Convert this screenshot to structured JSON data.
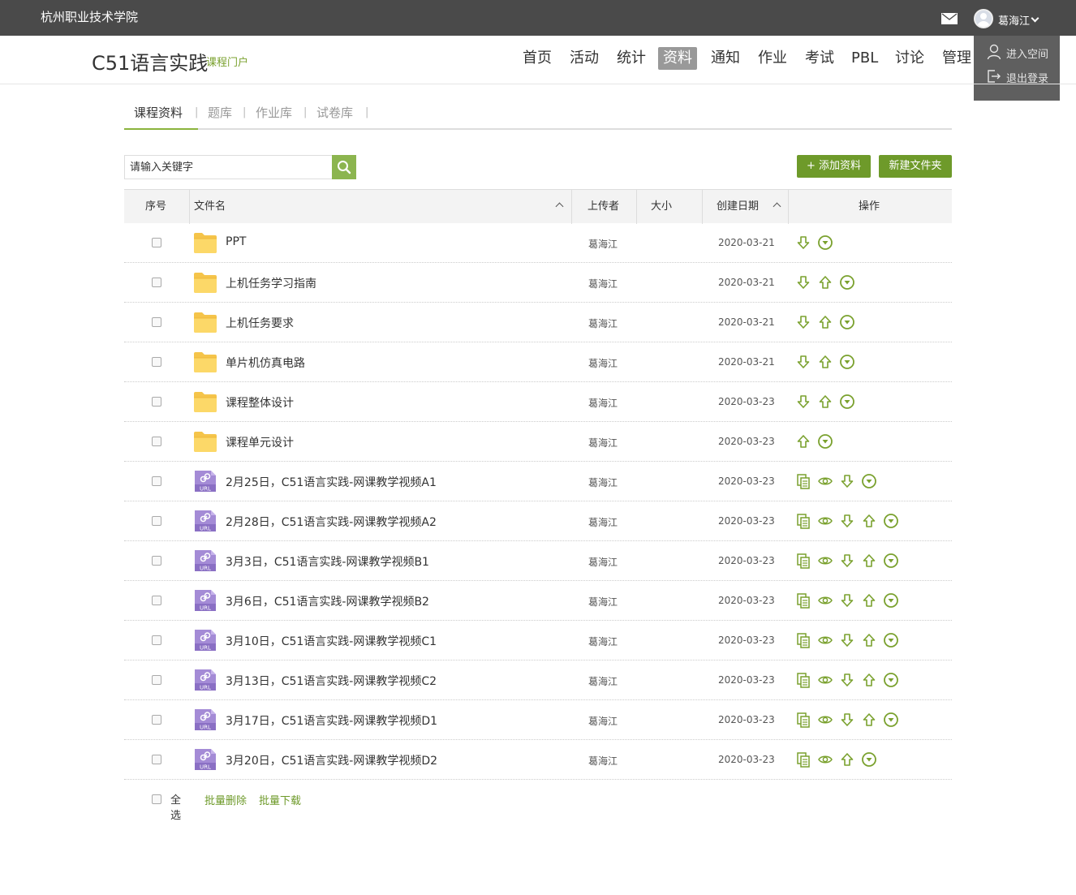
{
  "topbar": {
    "school": "杭州职业技术学院",
    "username": "葛海江"
  },
  "dropdown": {
    "items": [
      "进入空间",
      "退出登录"
    ]
  },
  "header": {
    "course_title": "C51语言实践",
    "portal": "课程门户",
    "nav": [
      "首页",
      "活动",
      "统计",
      "资料",
      "通知",
      "作业",
      "考试",
      "PBL",
      "讨论",
      "管理"
    ],
    "active_nav": "资料"
  },
  "subtabs": [
    "课程资料",
    "题库",
    "作业库",
    "试卷库"
  ],
  "search": {
    "placeholder": "请输入关键字"
  },
  "buttons": {
    "add": "+ 添加资料",
    "new_folder": "新建文件夹"
  },
  "table": {
    "headers": {
      "index": "序号",
      "name": "文件名",
      "uploader": "上传者",
      "size": "大小",
      "date": "创建日期",
      "ops": "操作"
    },
    "rows": [
      {
        "type": "folder",
        "name": "PPT",
        "uploader": "葛海江",
        "date": "2020-03-21",
        "ops": [
          "download",
          "more"
        ]
      },
      {
        "type": "folder",
        "name": "上机任务学习指南",
        "uploader": "葛海江",
        "date": "2020-03-21",
        "ops": [
          "download",
          "upload",
          "more"
        ]
      },
      {
        "type": "folder",
        "name": "上机任务要求",
        "uploader": "葛海江",
        "date": "2020-03-21",
        "ops": [
          "download",
          "upload",
          "more"
        ]
      },
      {
        "type": "folder",
        "name": "单片机仿真电路",
        "uploader": "葛海江",
        "date": "2020-03-21",
        "ops": [
          "download",
          "upload",
          "more"
        ]
      },
      {
        "type": "folder",
        "name": "课程整体设计",
        "uploader": "葛海江",
        "date": "2020-03-23",
        "ops": [
          "download",
          "upload",
          "more"
        ]
      },
      {
        "type": "folder",
        "name": "课程单元设计",
        "uploader": "葛海江",
        "date": "2020-03-23",
        "ops": [
          "upload",
          "more"
        ]
      },
      {
        "type": "url",
        "name": "2月25日，C51语言实践-网课教学视频A1",
        "uploader": "葛海江",
        "date": "2020-03-23",
        "ops": [
          "copy",
          "view",
          "download",
          "more"
        ]
      },
      {
        "type": "url",
        "name": "2月28日，C51语言实践-网课教学视频A2",
        "uploader": "葛海江",
        "date": "2020-03-23",
        "ops": [
          "copy",
          "view",
          "download",
          "upload",
          "more"
        ]
      },
      {
        "type": "url",
        "name": "3月3日，C51语言实践-网课教学视频B1",
        "uploader": "葛海江",
        "date": "2020-03-23",
        "ops": [
          "copy",
          "view",
          "download",
          "upload",
          "more"
        ]
      },
      {
        "type": "url",
        "name": "3月6日，C51语言实践-网课教学视频B2",
        "uploader": "葛海江",
        "date": "2020-03-23",
        "ops": [
          "copy",
          "view",
          "download",
          "upload",
          "more"
        ]
      },
      {
        "type": "url",
        "name": "3月10日，C51语言实践-网课教学视频C1",
        "uploader": "葛海江",
        "date": "2020-03-23",
        "ops": [
          "copy",
          "view",
          "download",
          "upload",
          "more"
        ]
      },
      {
        "type": "url",
        "name": "3月13日，C51语言实践-网课教学视频C2",
        "uploader": "葛海江",
        "date": "2020-03-23",
        "ops": [
          "copy",
          "view",
          "download",
          "upload",
          "more"
        ]
      },
      {
        "type": "url",
        "name": "3月17日，C51语言实践-网课教学视频D1",
        "uploader": "葛海江",
        "date": "2020-03-23",
        "ops": [
          "copy",
          "view",
          "download",
          "upload",
          "more"
        ]
      },
      {
        "type": "url",
        "name": "3月20日，C51语言实践-网课教学视频D2",
        "uploader": "葛海江",
        "date": "2020-03-23",
        "ops": [
          "copy",
          "view",
          "upload",
          "more"
        ]
      }
    ]
  },
  "footer": {
    "select_all": "全选",
    "batch_delete": "批量删除",
    "batch_download": "批量下载"
  },
  "colors": {
    "accent": "#6e9a2a",
    "topbar": "#4a4a4a",
    "icon_green": "#7aa12e"
  }
}
